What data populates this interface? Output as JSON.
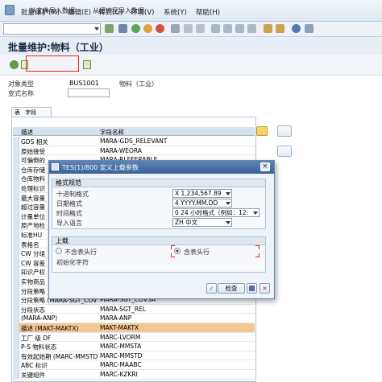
{
  "menu": {
    "items": [
      "批量维护(M)",
      "编辑(E)",
      "转到(G)",
      "环境(V)",
      "系统(Y)",
      "帮助(H)"
    ]
  },
  "title": "批量维护:物料（工业）",
  "app_toolbar": {
    "import_file_label": "从文件导入数据",
    "import_buffer_label": "从缓冲区导入数据"
  },
  "header": {
    "object_type_label": "对象类型",
    "object_type_value": "BUS1001",
    "object_type_desc": "物料（工业）",
    "variant_label": "变式名称",
    "variant_value": ""
  },
  "tabs": {
    "tab1": "表",
    "tab2": "字段"
  },
  "table": {
    "col_desc": "描述",
    "col_field": "字段名称",
    "rows": [
      {
        "desc": "GDS 相关",
        "field": "MARA-GDS_RELEVANT"
      },
      {
        "desc": "原始接受",
        "field": "MARA-WEORA"
      },
      {
        "desc": "可偏倒的",
        "field": "MARA-RLEFERABLE"
      },
      {
        "desc": "仓库存储",
        "field": ""
      },
      {
        "desc": "仓库物料",
        "field": ""
      },
      {
        "desc": "处理标识",
        "field": ""
      },
      {
        "desc": "最大容量",
        "field": ""
      },
      {
        "desc": "超过容量",
        "field": ""
      },
      {
        "desc": "计量单位",
        "field": ""
      },
      {
        "desc": "原产地检",
        "field": ""
      },
      {
        "desc": "标准HU",
        "field": ""
      },
      {
        "desc": "表格名",
        "field": ""
      },
      {
        "desc": "CW 分组",
        "field": ""
      },
      {
        "desc": "CW 容差",
        "field": ""
      },
      {
        "desc": "知识产权",
        "field": ""
      },
      {
        "desc": "实物商品",
        "field": ""
      },
      {
        "desc": "分段策略",
        "field": ""
      },
      {
        "desc": "分段策略 (MARA-SGT_COV",
        "field": "MARA-SGT_COVSA"
      },
      {
        "desc": "分段状态",
        "field": "MARA-SGT_REL"
      },
      {
        "desc": "(MARA-ANP)",
        "field": "MARA-ANP"
      },
      {
        "desc": "描述 (MAKT-MAKTX)",
        "field": "MAKT-MAKTX"
      },
      {
        "desc": "工厂 级 DF",
        "field": "MARC-LVORM"
      },
      {
        "desc": "P-S 物料状态",
        "field": "MARC-MMSTA"
      },
      {
        "desc": "有效起始期 (MARC-MMSTD",
        "field": "MARC-MMSTD"
      },
      {
        "desc": "ABC 标识",
        "field": "MARC-MAABC"
      },
      {
        "desc": "关键组件",
        "field": "MARC-KZKRI"
      }
    ],
    "highlight_index": 20
  },
  "dialog": {
    "title": "TES(1)/800 定义上载参数",
    "format_section": "格式规范",
    "decimal_label": "十进制格式",
    "decimal_value": "X 1,234,567.89",
    "date_label": "日期格式",
    "date_value": "4 YYYY.MM.DD",
    "time_label": "时间格式",
    "time_value": "0 24 小时格式（例如：12:",
    "lang_label": "导入语言",
    "lang_value": "ZH 中文",
    "upload_section": "上载",
    "no_header_label": "不含表头行",
    "with_header_label": "含表头行",
    "init_char_label": "初始化字符",
    "check_label": "检查"
  },
  "colors": {
    "accent": "#e1261c",
    "dialog_title": "#3b6398",
    "highlight_row": "#f2c894"
  }
}
